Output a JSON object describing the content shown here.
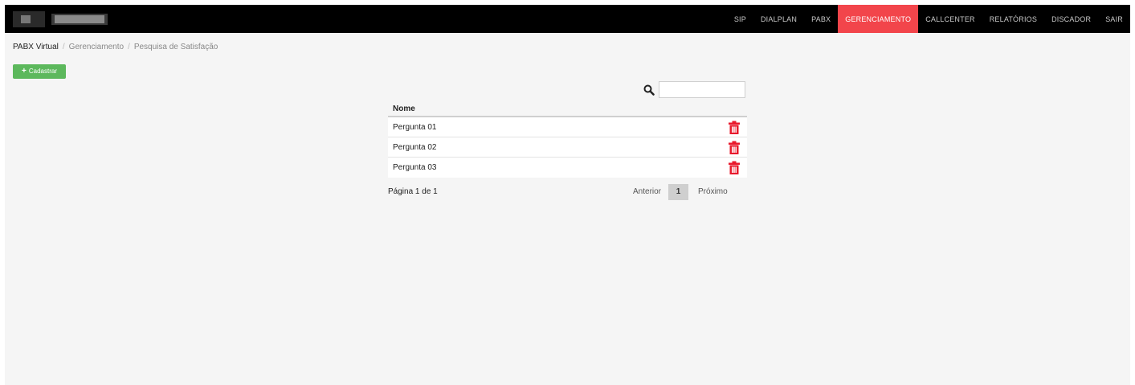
{
  "header": {
    "menu": [
      {
        "label": "SIP",
        "active": false
      },
      {
        "label": "DIALPLAN",
        "active": false
      },
      {
        "label": "PABX",
        "active": false
      },
      {
        "label": "GERENCIAMENTO",
        "active": true
      },
      {
        "label": "CALLCENTER",
        "active": false
      },
      {
        "label": "RELATÓRIOS",
        "active": false
      },
      {
        "label": "DISCADOR",
        "active": false
      },
      {
        "label": "SAIR",
        "active": false
      }
    ],
    "active_color": "#f2454b"
  },
  "breadcrumb": {
    "items": [
      "PABX Virtual",
      "Gerenciamento",
      "Pesquisa de Satisfação"
    ],
    "separator": "/"
  },
  "toolbar": {
    "add_label": "Cadastrar",
    "add_icon": "plus-icon",
    "add_color": "#5cb85c"
  },
  "search": {
    "value": "",
    "placeholder": "",
    "icon": "search-icon"
  },
  "table": {
    "columns": [
      "Nome"
    ],
    "rows": [
      {
        "name": "Pergunta 01"
      },
      {
        "name": "Pergunta 02"
      },
      {
        "name": "Pergunta 03"
      }
    ],
    "row_action_icon": "trash-icon",
    "row_action_color": "#e8192c"
  },
  "pagination": {
    "info": "Página 1 de 1",
    "prev_label": "Anterior",
    "current_page": "1",
    "next_label": "Próximo"
  }
}
